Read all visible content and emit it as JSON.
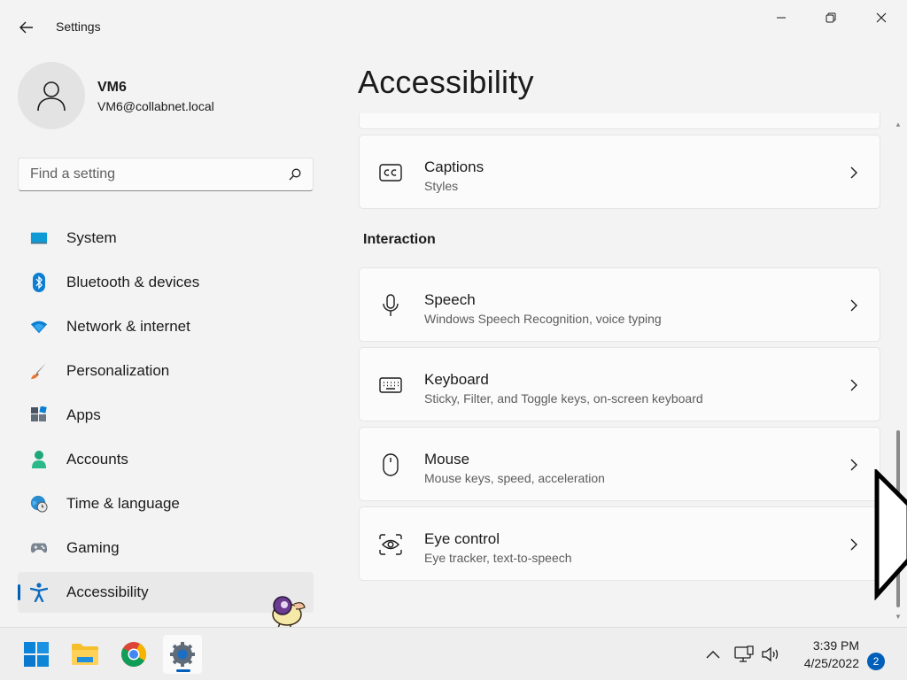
{
  "window": {
    "title": "Settings",
    "controls": {
      "minimize": "minimize-icon",
      "maximize": "restore-icon",
      "close": "close-icon"
    }
  },
  "profile": {
    "name": "VM6",
    "email": "VM6@collabnet.local",
    "avatar_icon": "user-icon"
  },
  "search": {
    "placeholder": "Find a setting",
    "value": ""
  },
  "sidebar": {
    "items": [
      {
        "label": "System",
        "icon": "system-icon",
        "selected": false
      },
      {
        "label": "Bluetooth & devices",
        "icon": "bluetooth-icon",
        "selected": false
      },
      {
        "label": "Network & internet",
        "icon": "wifi-icon",
        "selected": false
      },
      {
        "label": "Personalization",
        "icon": "brush-icon",
        "selected": false
      },
      {
        "label": "Apps",
        "icon": "apps-icon",
        "selected": false
      },
      {
        "label": "Accounts",
        "icon": "accounts-icon",
        "selected": false
      },
      {
        "label": "Time & language",
        "icon": "globe-clock-icon",
        "selected": false
      },
      {
        "label": "Gaming",
        "icon": "gamepad-icon",
        "selected": false
      },
      {
        "label": "Accessibility",
        "icon": "accessibility-icon",
        "selected": true
      }
    ]
  },
  "main": {
    "page_title": "Accessibility",
    "cards_top": [
      {
        "title": "Captions",
        "subtitle": "Styles",
        "icon": "captions-icon"
      }
    ],
    "section_interaction": "Interaction",
    "cards_interaction": [
      {
        "title": "Speech",
        "subtitle": "Windows Speech Recognition, voice typing",
        "icon": "microphone-icon"
      },
      {
        "title": "Keyboard",
        "subtitle": "Sticky, Filter, and Toggle keys, on-screen keyboard",
        "icon": "keyboard-icon"
      },
      {
        "title": "Mouse",
        "subtitle": "Mouse keys, speed, acceleration",
        "icon": "mouse-icon"
      },
      {
        "title": "Eye control",
        "subtitle": "Eye tracker, text-to-speech",
        "icon": "eye-control-icon"
      }
    ]
  },
  "taskbar": {
    "apps": [
      {
        "name": "Start",
        "icon": "windows-start-icon"
      },
      {
        "name": "File Explorer",
        "icon": "folder-icon"
      },
      {
        "name": "Chrome",
        "icon": "chrome-icon"
      },
      {
        "name": "Settings",
        "icon": "settings-gear-icon",
        "active": true
      }
    ],
    "tray": {
      "icons": [
        "chevron-up-icon",
        "network-icon",
        "volume-icon"
      ],
      "time": "3:39 PM",
      "date": "4/25/2022",
      "notifications": "2"
    }
  },
  "colors": {
    "accent": "#005fb8",
    "background": "#f3f3f3",
    "card": "#fbfbfb"
  }
}
